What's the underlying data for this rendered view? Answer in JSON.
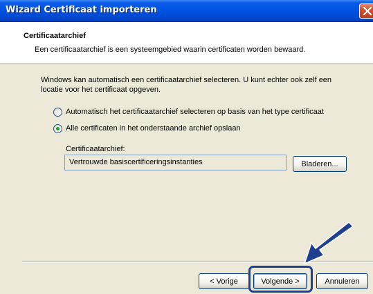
{
  "window": {
    "title": "Wizard Certificaat importeren"
  },
  "header": {
    "title": "Certificaatarchief",
    "subtitle": "Een certificaatarchief is een systeemgebied waarin certificaten worden bewaard."
  },
  "body": {
    "description": "Windows kan automatisch een certificaatarchief selecteren. U kunt echter ook zelf een locatie voor het certificaat opgeven.",
    "options": [
      {
        "label": "Automatisch het certificaatarchief selecteren op basis van het type certificaat",
        "checked": false
      },
      {
        "label": "Alle certificaten in het onderstaande archief opslaan",
        "checked": true
      }
    ],
    "store_label": "Certificaatarchief:",
    "store_value": "Vertrouwde basiscertificeringsinstanties",
    "browse_label": "Bladeren..."
  },
  "footer": {
    "back_label": "< Vorige",
    "next_label": "Volgende >",
    "cancel_label": "Annuleren"
  },
  "colors": {
    "titlebar": "#0054e3",
    "dialog_bg": "#ece9d8",
    "radio_dot": "#21a121",
    "callout": "#1f3f8f"
  }
}
